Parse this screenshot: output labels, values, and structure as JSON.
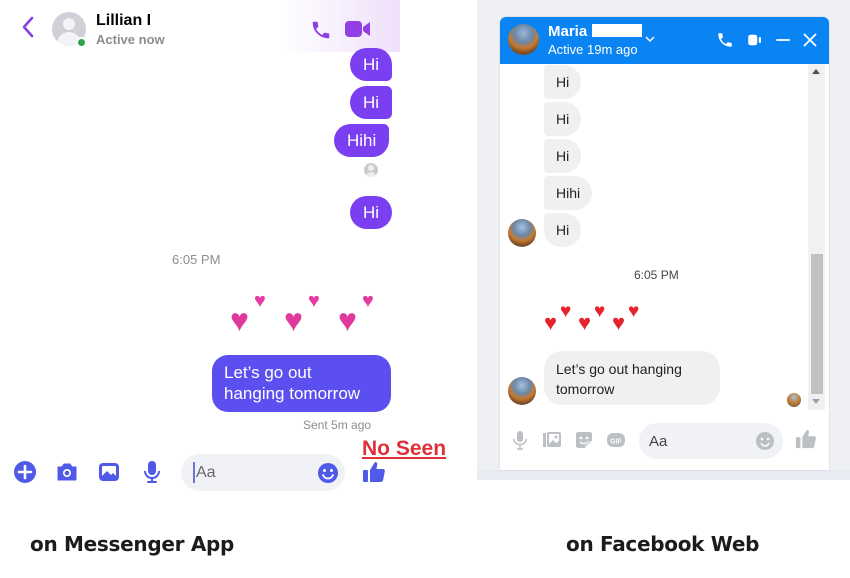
{
  "messenger_app": {
    "header": {
      "contact_name": "Lillian I",
      "status": "Active now",
      "icons": [
        "back-chevron-icon",
        "phone-icon",
        "video-camera-icon"
      ]
    },
    "messages": [
      {
        "from": "me",
        "text": "Hi"
      },
      {
        "from": "me",
        "text": "Hi"
      },
      {
        "from": "me",
        "text": "Hihi"
      },
      {
        "from": "me",
        "text": "Hi"
      }
    ],
    "timestamp": "6:05 PM",
    "hearts_emoji": "💕💕💕",
    "last_message": {
      "line1": "Let’s go out",
      "line2": "hanging tomorrow"
    },
    "sent_status": "Sent 5m ago",
    "annotation": "No Seen",
    "composer": {
      "placeholder": "Aa",
      "icons": [
        "plus-icon",
        "camera-icon",
        "image-icon",
        "microphone-icon",
        "emoji-icon",
        "thumbs-up-icon"
      ]
    },
    "caption": "on Messenger App",
    "colors": {
      "accent": "#7b3ff2",
      "bubble_last": "#5b4ff0",
      "annotation": "#e0303a"
    }
  },
  "facebook_web": {
    "header": {
      "contact_name": "Maria",
      "status": "Active 19m ago",
      "icons": [
        "chevron-down-icon",
        "phone-icon",
        "video-camera-icon",
        "minimize-icon",
        "close-icon"
      ]
    },
    "messages": [
      {
        "from": "them",
        "text": "Hi"
      },
      {
        "from": "them",
        "text": "Hi"
      },
      {
        "from": "them",
        "text": "Hi"
      },
      {
        "from": "them",
        "text": "Hihi"
      },
      {
        "from": "them",
        "text": "Hi"
      }
    ],
    "timestamp": "6:05 PM",
    "hearts_emoji": "💕💕💕",
    "last_message": {
      "line1": "Let’s go out hanging",
      "line2": "tomorrow"
    },
    "composer": {
      "placeholder": "Aa",
      "icons": [
        "microphone-icon",
        "image-icon",
        "sticker-icon",
        "gif-icon",
        "emoji-icon",
        "thumbs-up-icon"
      ],
      "gif_label": "GIF"
    },
    "caption": "on Facebook Web",
    "colors": {
      "header": "#0b84f3",
      "bubble": "#f0f0f0"
    }
  }
}
